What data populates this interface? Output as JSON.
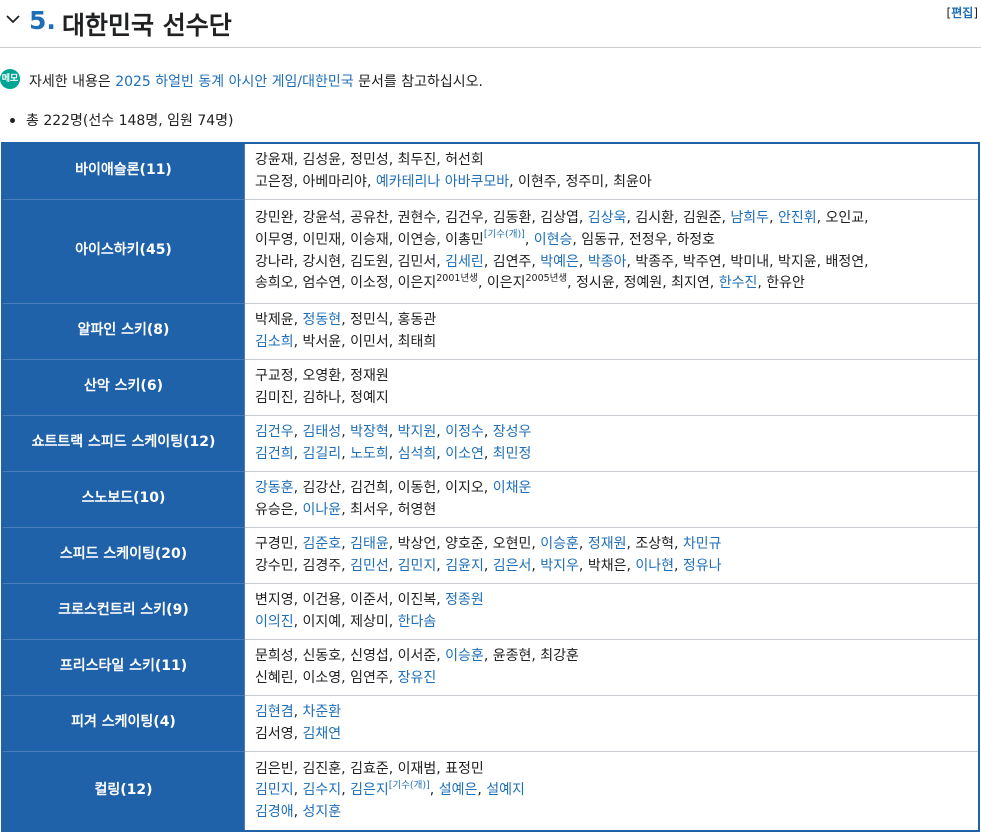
{
  "heading": {
    "number": "5.",
    "title": "대한민국 선수단",
    "edit_open": "[",
    "edit_label": "편집",
    "edit_close": "]"
  },
  "notice": {
    "icon": "memo-icon",
    "icon_text": "메모",
    "prefix": "자세한 내용은 ",
    "link": "2025 하얼빈 동계 아시안 게임/대한민국",
    "suffix": " 문서를 참고하십시오."
  },
  "summary": "총 222명(선수 148명, 임원 74명)",
  "colors": {
    "link": "#1f6fb8",
    "category_bg": "#1f62a9"
  },
  "rows": [
    {
      "category": "바이애슬론(11)",
      "lines": [
        [
          {
            "t": "강윤재, 김성윤, 정민성, 최두진, 허선회"
          }
        ],
        [
          {
            "t": "고은정, 아베마리야, "
          },
          {
            "t": "예카테리나 아바쿠모바",
            "l": true
          },
          {
            "t": ", 이현주, 정주미, 최윤아"
          }
        ]
      ]
    },
    {
      "category": "아이스하키(45)",
      "lines": [
        [
          {
            "t": "강민완, 강윤석, 공유찬, 권현수, 김건우, 김동환, 김상엽, "
          },
          {
            "t": "김상욱",
            "l": true
          },
          {
            "t": ", 김시환, 김원준, "
          },
          {
            "t": "남희두",
            "l": true
          },
          {
            "t": ", "
          },
          {
            "t": "안진휘",
            "l": true
          },
          {
            "t": ", 오인교,"
          }
        ],
        [
          {
            "t": "이무영, 이민재, 이승재, 이연승, 이총민"
          },
          {
            "t": "[기수(개)]",
            "l": true,
            "sup": true
          },
          {
            "t": ", "
          },
          {
            "t": "이현승",
            "l": true
          },
          {
            "t": ", 임동규, 전정우, 하정호"
          }
        ],
        [
          {
            "t": "강나라, 강시현, 김도원, 김민서, "
          },
          {
            "t": "김세린",
            "l": true
          },
          {
            "t": ", 김연주, "
          },
          {
            "t": "박예은",
            "l": true
          },
          {
            "t": ", "
          },
          {
            "t": "박종아",
            "l": true
          },
          {
            "t": ", 박종주, 박주연, 박미내, 박지윤, 배정연,"
          }
        ],
        [
          {
            "t": "송희오, 엄수연, 이소정, 이은지"
          },
          {
            "t": "2001년생",
            "sup": true
          },
          {
            "t": ", 이은지"
          },
          {
            "t": "2005년생",
            "sup": true
          },
          {
            "t": ", 정시윤, 정예원, 최지연, "
          },
          {
            "t": "한수진",
            "l": true
          },
          {
            "t": ", 한유안"
          }
        ]
      ]
    },
    {
      "category": "알파인 스키(8)",
      "lines": [
        [
          {
            "t": "박제윤, "
          },
          {
            "t": "정동현",
            "l": true
          },
          {
            "t": ", 정민식, 홍동관"
          }
        ],
        [
          {
            "t": "김소희",
            "l": true
          },
          {
            "t": ", 박서윤, 이민서, 최태희"
          }
        ]
      ]
    },
    {
      "category": "산악 스키(6)",
      "lines": [
        [
          {
            "t": "구교정, 오영환, 정재원"
          }
        ],
        [
          {
            "t": "김미진, 김하나, 정예지"
          }
        ]
      ]
    },
    {
      "category": "쇼트트랙 스피드 스케이팅(12)",
      "lines": [
        [
          {
            "t": "김건우",
            "l": true
          },
          {
            "t": ", "
          },
          {
            "t": "김태성",
            "l": true
          },
          {
            "t": ", "
          },
          {
            "t": "박장혁",
            "l": true
          },
          {
            "t": ", "
          },
          {
            "t": "박지원",
            "l": true
          },
          {
            "t": ", "
          },
          {
            "t": "이정수",
            "l": true
          },
          {
            "t": ", "
          },
          {
            "t": "장성우",
            "l": true
          }
        ],
        [
          {
            "t": "김건희",
            "l": true
          },
          {
            "t": ", "
          },
          {
            "t": "김길리",
            "l": true
          },
          {
            "t": ", "
          },
          {
            "t": "노도희",
            "l": true
          },
          {
            "t": ", "
          },
          {
            "t": "심석희",
            "l": true
          },
          {
            "t": ", "
          },
          {
            "t": "이소연",
            "l": true
          },
          {
            "t": ", "
          },
          {
            "t": "최민정",
            "l": true
          }
        ]
      ]
    },
    {
      "category": "스노보드(10)",
      "lines": [
        [
          {
            "t": "강동훈",
            "l": true
          },
          {
            "t": ", 김강산, 김건희, 이동헌, 이지오, "
          },
          {
            "t": "이채운",
            "l": true
          }
        ],
        [
          {
            "t": "유승은, "
          },
          {
            "t": "이나윤",
            "l": true
          },
          {
            "t": ", 최서우, 허영현"
          }
        ]
      ]
    },
    {
      "category": "스피드 스케이팅(20)",
      "lines": [
        [
          {
            "t": "구경민, "
          },
          {
            "t": "김준호",
            "l": true
          },
          {
            "t": ", "
          },
          {
            "t": "김태윤",
            "l": true
          },
          {
            "t": ", 박상언, 양호준, 오현민, "
          },
          {
            "t": "이승훈",
            "l": true
          },
          {
            "t": ", "
          },
          {
            "t": "정재원",
            "l": true
          },
          {
            "t": ", 조상혁, "
          },
          {
            "t": "차민규",
            "l": true
          }
        ],
        [
          {
            "t": "강수민, 김경주, "
          },
          {
            "t": "김민선",
            "l": true
          },
          {
            "t": ", "
          },
          {
            "t": "김민지",
            "l": true
          },
          {
            "t": ", "
          },
          {
            "t": "김윤지",
            "l": true
          },
          {
            "t": ", "
          },
          {
            "t": "김은서",
            "l": true
          },
          {
            "t": ", "
          },
          {
            "t": "박지우",
            "l": true
          },
          {
            "t": ", 박채은, "
          },
          {
            "t": "이나현",
            "l": true
          },
          {
            "t": ", "
          },
          {
            "t": "정유나",
            "l": true
          }
        ]
      ]
    },
    {
      "category": "크로스컨트리 스키(9)",
      "lines": [
        [
          {
            "t": "변지영, 이건용, 이준서, 이진복, "
          },
          {
            "t": "정종원",
            "l": true
          }
        ],
        [
          {
            "t": "이의진",
            "l": true
          },
          {
            "t": ", 이지예, 제상미, "
          },
          {
            "t": "한다솜",
            "l": true
          }
        ]
      ]
    },
    {
      "category": "프리스타일 스키(11)",
      "lines": [
        [
          {
            "t": "문희성, 신동호, 신영섭, 이서준, "
          },
          {
            "t": "이승훈",
            "l": true
          },
          {
            "t": ", 윤종현, 최강훈"
          }
        ],
        [
          {
            "t": "신혜린, 이소영, 임연주, "
          },
          {
            "t": "장유진",
            "l": true
          }
        ]
      ]
    },
    {
      "category": "피겨 스케이팅(4)",
      "lines": [
        [
          {
            "t": "김현겸",
            "l": true
          },
          {
            "t": ", "
          },
          {
            "t": "차준환",
            "l": true
          }
        ],
        [
          {
            "t": "김서영, "
          },
          {
            "t": "김채연",
            "l": true
          }
        ]
      ]
    },
    {
      "category": "컬링(12)",
      "lines": [
        [
          {
            "t": "김은빈, 김진훈, 김효준, 이재범, 표정민"
          }
        ],
        [
          {
            "t": "김민지",
            "l": true
          },
          {
            "t": ", "
          },
          {
            "t": "김수지",
            "l": true
          },
          {
            "t": ", "
          },
          {
            "t": "김은지",
            "l": true
          },
          {
            "t": "[기수(개)]",
            "l": true,
            "sup": true
          },
          {
            "t": ", "
          },
          {
            "t": "설예은",
            "l": true
          },
          {
            "t": ", "
          },
          {
            "t": "설예지",
            "l": true
          }
        ],
        [
          {
            "t": "김경애",
            "l": true
          },
          {
            "t": ", "
          },
          {
            "t": "성지훈",
            "l": true
          }
        ]
      ]
    }
  ]
}
